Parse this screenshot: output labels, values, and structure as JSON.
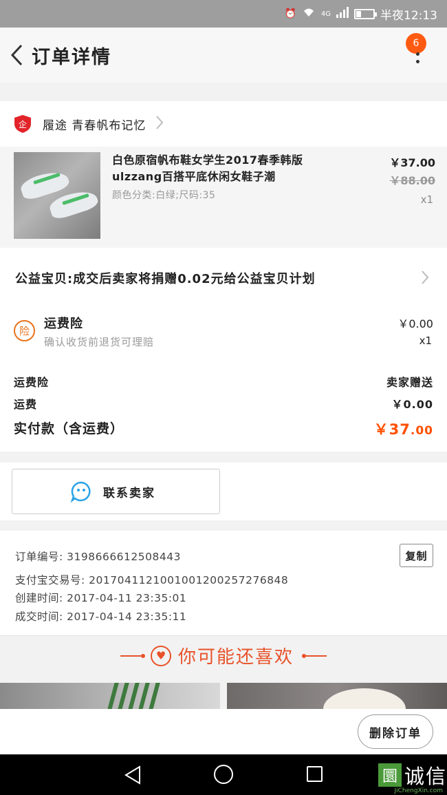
{
  "status_bar": {
    "time": "半夜12:13",
    "network": "4G"
  },
  "header": {
    "title": "订单详情",
    "badge_count": "6"
  },
  "shop": {
    "name": "履途 青春帆布记忆"
  },
  "product": {
    "title": "白色原宿帆布鞋女学生2017春季韩版ulzzang百搭平底休闲女鞋子潮",
    "spec": "颜色分类:白绿;尺码:35",
    "price": "￥37.00",
    "original_price": "￥88.00",
    "quantity": "x1"
  },
  "charity": {
    "text": "公益宝贝:成交后卖家将捐赠0.02元给公益宝贝计划"
  },
  "insurance": {
    "icon_text": "险",
    "title": "运费险",
    "subtitle": "确认收货前退货可理赔",
    "price": "￥0.00",
    "quantity": "x1"
  },
  "summary": {
    "insurance_label": "运费险",
    "insurance_value": "卖家赠送",
    "shipping_label": "运费",
    "shipping_value": "￥0.00",
    "total_label": "实付款（含运费）",
    "total_int": "￥37",
    "total_dec": ".00"
  },
  "contact": {
    "label": "联系卖家"
  },
  "order_info": {
    "order_no": "订单编号: 3198666612508443",
    "alipay_no": "支付宝交易号: 2017041121001001200257276848",
    "created": "创建时间: 2017-04-11 23:35:01",
    "completed": "成交时间: 2017-04-14 23:35:11",
    "copy_label": "复制"
  },
  "recommend": {
    "title": "你可能还喜欢"
  },
  "actions": {
    "delete_label": "删除订单"
  },
  "watermark": {
    "logo": "圜",
    "text": "诚信",
    "sub": "JiChengXin.com"
  },
  "colors": {
    "accent": "#ff5000",
    "recommend": "#e8522a",
    "badge": "#ff5a12",
    "shop_icon": "#e2242a"
  }
}
